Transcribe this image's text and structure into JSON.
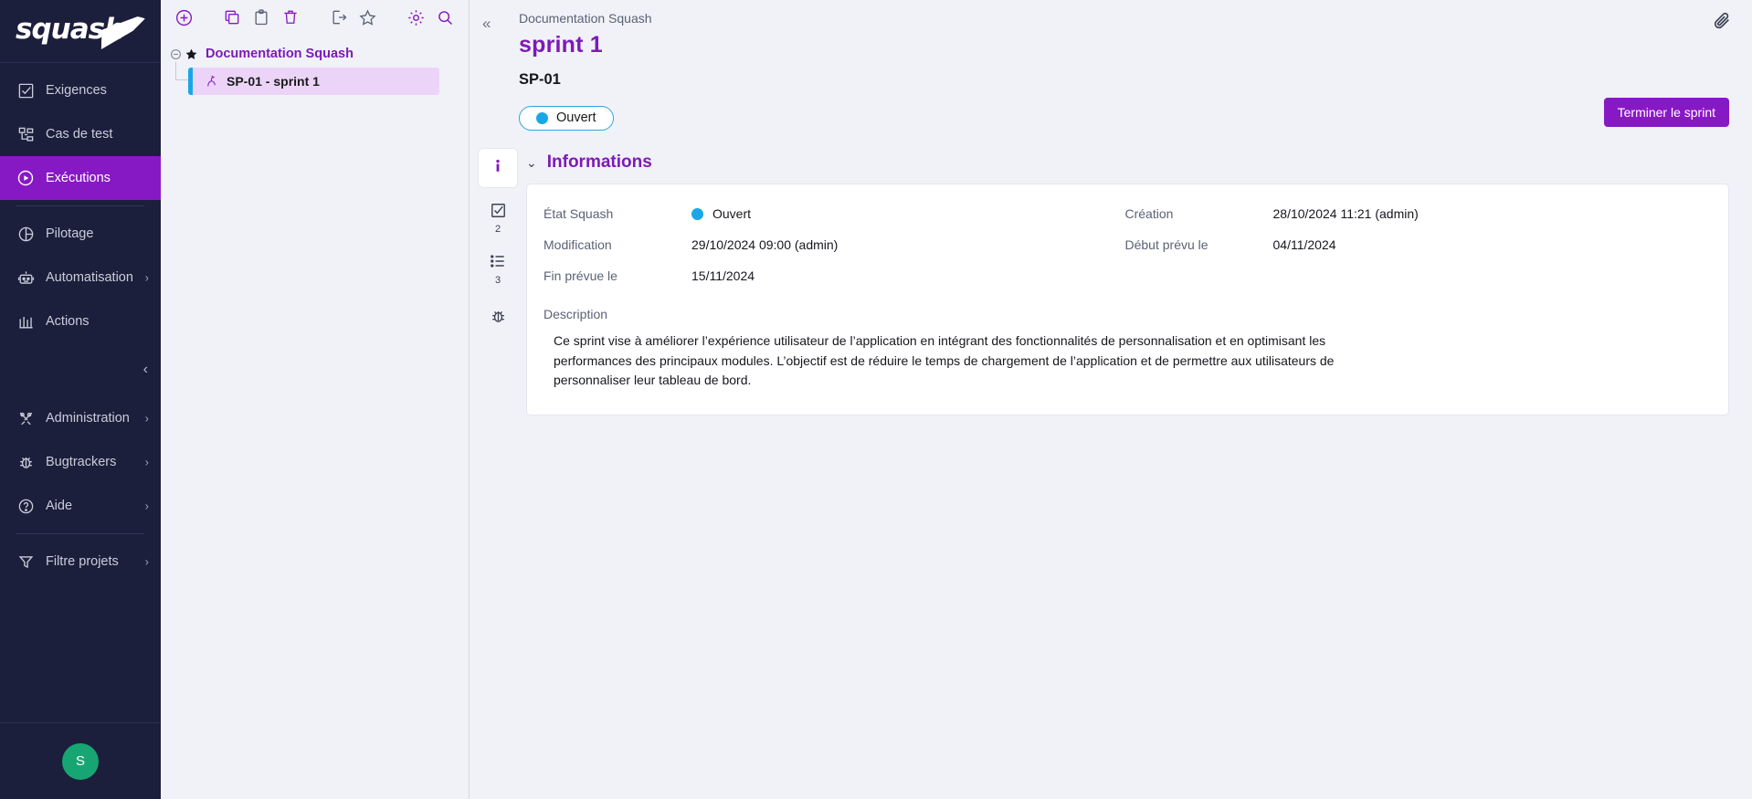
{
  "brand": {
    "name": "squash",
    "logo_icon": "squash-logo"
  },
  "sidebar": {
    "items": [
      {
        "label": "Exigences",
        "icon": "requirements-icon",
        "active": false,
        "expandable": false
      },
      {
        "label": "Cas de test",
        "icon": "test-case-icon",
        "active": false,
        "expandable": false
      },
      {
        "label": "Exécutions",
        "icon": "executions-icon",
        "active": true,
        "expandable": false
      },
      {
        "label": "Pilotage",
        "icon": "pilotage-chart-icon",
        "active": false,
        "expandable": false
      },
      {
        "label": "Automatisation",
        "icon": "robot-icon",
        "active": false,
        "expandable": true
      },
      {
        "label": "Actions",
        "icon": "actions-icon",
        "active": false,
        "expandable": false
      },
      {
        "label": "Administration",
        "icon": "tools-icon",
        "active": false,
        "expandable": true
      },
      {
        "label": "Bugtrackers",
        "icon": "bug-icon",
        "active": false,
        "expandable": true
      },
      {
        "label": "Aide",
        "icon": "help-circle-icon",
        "active": false,
        "expandable": true
      },
      {
        "label": "Filtre projets",
        "icon": "funnel-icon",
        "active": false,
        "expandable": true
      }
    ],
    "collapse_icon": "chevron-left-icon",
    "avatar_initial": "S",
    "avatar_color": "#17a673"
  },
  "tree": {
    "toolbar": [
      {
        "name": "add-icon",
        "label": "Ajouter"
      },
      {
        "name": "copy-icon",
        "label": "Copier"
      },
      {
        "name": "paste-icon",
        "label": "Coller"
      },
      {
        "name": "delete-icon",
        "label": "Supprimer"
      },
      {
        "name": "export-icon",
        "label": "Exporter"
      },
      {
        "name": "favorite-star-icon",
        "label": "Favoris"
      },
      {
        "name": "gear-icon",
        "label": "Paramètres"
      },
      {
        "name": "search-icon",
        "label": "Rechercher"
      }
    ],
    "root": {
      "label": "Documentation Squash",
      "toggle": "−",
      "icon": "star-filled-icon"
    },
    "child": {
      "label": "SP-01 - sprint 1",
      "icon": "sprint-icon",
      "selected": true
    }
  },
  "header": {
    "collapse_icon": "chevrons-left-icon",
    "attachment_icon": "paperclip-icon",
    "breadcrumb": "Documentation Squash",
    "title": "sprint 1",
    "reference": "SP-01",
    "status": {
      "label": "Ouvert",
      "color": "#1aa7e8"
    },
    "primary_button": "Terminer le sprint",
    "primary_button_color": "#8719c4"
  },
  "tabs": [
    {
      "name": "info-tab",
      "icon": "info-icon",
      "badge": "",
      "active": true
    },
    {
      "name": "test-plan-tab",
      "icon": "checkbox-icon",
      "badge": "2",
      "active": false
    },
    {
      "name": "list-tab",
      "icon": "list-icon",
      "badge": "3",
      "active": false
    },
    {
      "name": "bugs-tab",
      "icon": "bug-icon",
      "badge": "",
      "active": false
    }
  ],
  "information": {
    "section_title": "Informations",
    "fields": [
      {
        "label": "État Squash",
        "value": "Ouvert",
        "has_dot": true
      },
      {
        "label": "Création",
        "value": "28/10/2024 11:21 (admin)",
        "has_dot": false
      },
      {
        "label": "Modification",
        "value": "29/10/2024 09:00 (admin)",
        "has_dot": false
      },
      {
        "label": "Début prévu le",
        "value": "04/11/2024",
        "has_dot": false
      },
      {
        "label": "Fin prévue le",
        "value": "15/11/2024",
        "has_dot": false
      }
    ],
    "description_label": "Description",
    "description_text": "Ce sprint vise à améliorer l’expérience utilisateur de l’application en intégrant des fonctionnalités de personnalisation et en optimisant les performances des principaux modules. L’objectif est de réduire le temps de chargement de l’application et de permettre aux utilisateurs de personnaliser leur tableau de bord."
  }
}
